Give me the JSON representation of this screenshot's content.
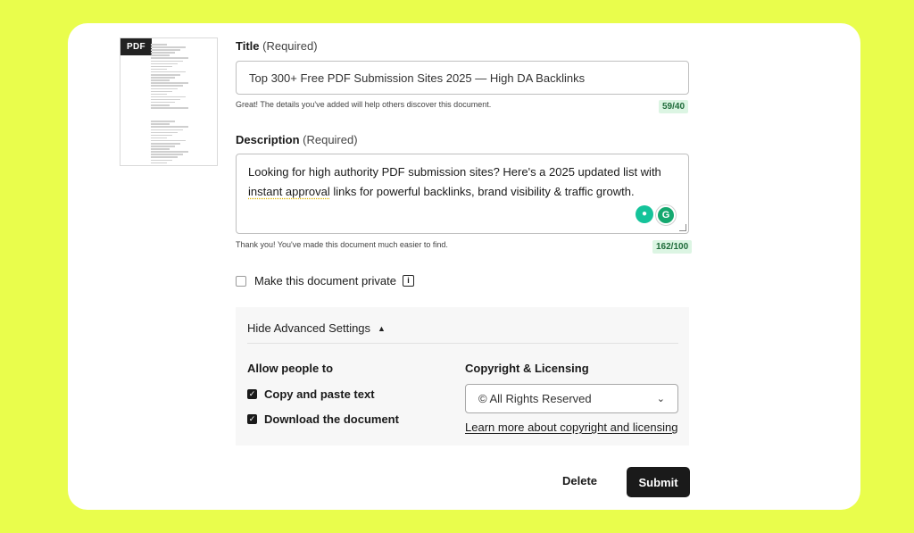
{
  "thumbnail": {
    "badge": "PDF"
  },
  "title_field": {
    "label": "Title",
    "required": "(Required)",
    "value": "Top 300+ Free PDF Submission Sites 2025 — High DA Backlinks",
    "hint": "Great! The details you've added will help others discover this document.",
    "count": "59/40"
  },
  "description_field": {
    "label": "Description",
    "required": "(Required)",
    "value_line1": "Looking for high authority PDF submission sites? Here's a 2025 updated list with",
    "value_line2_underlined": "instant approval",
    "value_line2_rest": " links for powerful backlinks, brand visibility & traffic growth.",
    "hint": "Thank you! You've made this document much easier to find.",
    "count": "162/100"
  },
  "private_option": {
    "label": "Make this document private",
    "checked": false
  },
  "advanced": {
    "toggle_label": "Hide Advanced Settings",
    "allow_heading": "Allow people to",
    "allow_options": [
      {
        "label": "Copy and paste text",
        "checked": true
      },
      {
        "label": "Download the document",
        "checked": true
      }
    ],
    "copyright_heading": "Copyright & Licensing",
    "copyright_selected": "© All Rights Reserved",
    "learn_more": "Learn more about copyright and licensing"
  },
  "actions": {
    "delete_label": "Delete",
    "submit_label": "Submit"
  },
  "colors": {
    "background": "#e9fd4c",
    "count_text": "#1f6b3a",
    "count_bg": "#dcf5e3",
    "grammarly": "#15c39a",
    "submit_bg": "#1a1a1a"
  },
  "icons": {
    "bulb": "lightbulb-icon",
    "grammarly": "grammarly-icon",
    "info": "info-icon",
    "chevron_up": "chevron-up-icon",
    "chevron_down": "chevron-down-icon",
    "check": "checkmark-icon"
  }
}
